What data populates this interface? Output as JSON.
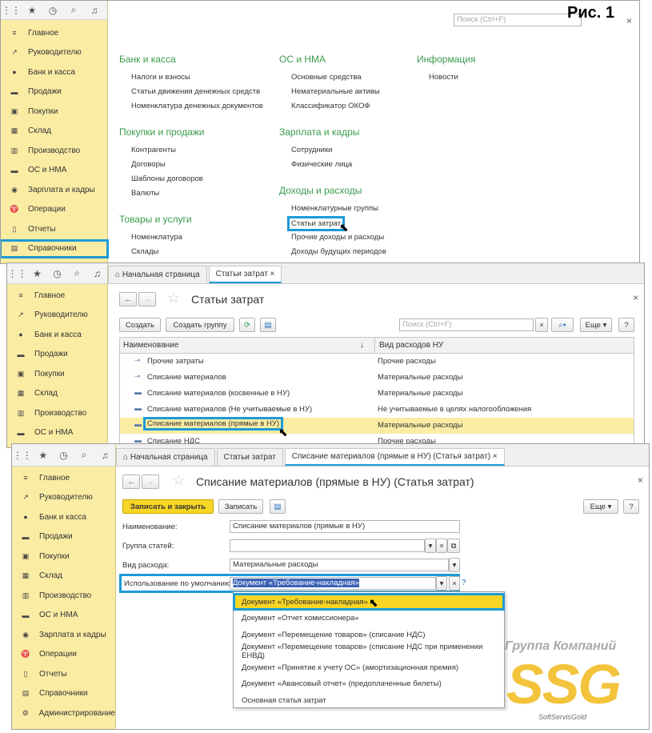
{
  "fig_label": "Рис. 1",
  "icons": [
    "apps-grid-icon",
    "star-icon",
    "history-icon",
    "search-icon",
    "bell-icon"
  ],
  "sidebar1": [
    "Главное",
    "Руководителю",
    "Банк и касса",
    "Продажи",
    "Покупки",
    "Склад",
    "Производство",
    "ОС и НМА",
    "Зарплата и кадры",
    "Операции",
    "Отчеты",
    "Справочники"
  ],
  "sidebar2": [
    "Главное",
    "Руководителю",
    "Банк и касса",
    "Продажи",
    "Покупки",
    "Склад",
    "Производство",
    "ОС и НМА"
  ],
  "sidebar3": [
    "Главное",
    "Руководителю",
    "Банк и касса",
    "Продажи",
    "Покупки",
    "Склад",
    "Производство",
    "ОС и НМА",
    "Зарплата и кадры",
    "Операции",
    "Отчеты",
    "Справочники",
    "Администрирование"
  ],
  "w1": {
    "search_ph": "Поиск (Ctrl+F)",
    "sections": [
      {
        "title": "Банк и касса",
        "items": [
          "Налоги и взносы",
          "Статьи движения денежных средств",
          "Номенклатура денежных документов"
        ]
      },
      {
        "title": "Покупки и продажи",
        "items": [
          "Контрагенты",
          "Договоры",
          "Шаблоны договоров",
          "Валюты"
        ]
      },
      {
        "title": "Товары и услуги",
        "items": [
          "Номенклатура",
          "Склады"
        ]
      },
      {
        "title": "ОС и НМА",
        "items": [
          "Основные средства",
          "Нематериальные активы",
          "Классификатор ОКОФ"
        ]
      },
      {
        "title": "Зарплата и кадры",
        "items": [
          "Сотрудники",
          "Физические лица"
        ]
      },
      {
        "title": "Доходы и расходы",
        "items": [
          "Номенклатурные группы",
          "Статьи затрат",
          "Прочие доходы и расходы",
          "Доходы будущих периодов"
        ]
      },
      {
        "title": "Информация",
        "items": [
          "Новости"
        ]
      }
    ]
  },
  "w2": {
    "tabs": [
      "Начальная страница",
      "Статьи затрат"
    ],
    "title": "Статьи затрат",
    "btn_create": "Создать",
    "btn_group": "Создать группу",
    "search_ph": "Поиск (Ctrl+F)",
    "more": "Еще",
    "help": "?",
    "col1": "Наименование",
    "col2": "Вид расходов НУ",
    "rows": [
      {
        "name": "Прочие затраты",
        "kind": "Прочие расходы"
      },
      {
        "name": "Списание материалов",
        "kind": "Материальные расходы"
      },
      {
        "name": "Списание материалов (косвенные в НУ)",
        "kind": "Материальные расходы"
      },
      {
        "name": "Списание материалов (Не учитываемые в НУ)",
        "kind": "Не учитываемые в целях налогообложения"
      },
      {
        "name": "Списание материалов (прямые в НУ)",
        "kind": "Материальные расходы"
      },
      {
        "name": "Списание НДС",
        "kind": "Прочие расходы"
      }
    ]
  },
  "w3": {
    "tabs": [
      "Начальная страница",
      "Статьи затрат",
      "Списание материалов (прямые в НУ) (Статья затрат)"
    ],
    "title": "Списание материалов (прямые в НУ) (Статья затрат)",
    "btn_save_close": "Записать и закрыть",
    "btn_save": "Записать",
    "more": "Еще",
    "help": "?",
    "lbl_name": "Наименование:",
    "val_name": "Списание материалов (прямые в НУ)",
    "lbl_group": "Группа статей:",
    "lbl_kind": "Вид расхода:",
    "val_kind": "Материальные расходы",
    "lbl_use": "Использование по умолчанию:",
    "val_use": "Документ «Требование-накладная»",
    "options": [
      "Документ «Требование-накладная»",
      "Документ «Отчет комиссионера»",
      "Документ «Перемещение товаров» (списание НДС)",
      "Документ «Перемещение товаров» (списание НДС при применении ЕНВД)",
      "Документ «Принятие к учету ОС» (амортизационная премия)",
      "Документ «Авансовый отчет» (предоплаченные билеты)",
      "Основная статья затрат"
    ]
  },
  "watermark": {
    "top": "Группа Компаний",
    "big": "SSG",
    "bottom": "SoftServisGold"
  }
}
